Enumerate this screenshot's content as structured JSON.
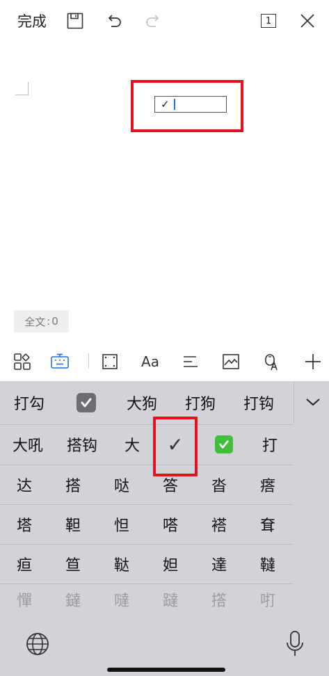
{
  "toolbar": {
    "done_label": "完成",
    "page_indicator": "1"
  },
  "document": {
    "input_content": "✓"
  },
  "status": {
    "wordcount_label": "全文",
    "wordcount_sep": ":",
    "wordcount_value": "0"
  },
  "format_toolbar": {
    "font_label": "Aa"
  },
  "candidates": {
    "row1": [
      "打勾",
      "大狗",
      "打狗",
      "打钩"
    ],
    "row2": [
      "大吼",
      "搭钩",
      "大",
      "✓",
      "打"
    ],
    "row3": [
      "达",
      "搭",
      "哒",
      "答",
      "沓",
      "瘩"
    ],
    "row4": [
      "塔",
      "靼",
      "怛",
      "嗒",
      "褡",
      "耷"
    ],
    "row5": [
      "疸",
      "笪",
      "鞑",
      "妲",
      "達",
      "韃"
    ],
    "row6": [
      "憚",
      "鐽",
      "噠",
      "躂",
      "撘",
      "咑"
    ]
  },
  "colors": {
    "highlight": "#e8101a",
    "accent": "#2a6fd6",
    "keyboard_bg": "#d1d3d9"
  },
  "icons": [
    "save-icon",
    "undo-icon",
    "redo-icon",
    "page-count-icon",
    "close-icon",
    "apps-icon",
    "keyboard-icon",
    "crop-icon",
    "align-icon",
    "image-icon",
    "voice-translate-icon",
    "add-icon",
    "checkbox-emoji-icon",
    "green-check-emoji-icon",
    "chevron-down-icon",
    "globe-icon",
    "microphone-icon"
  ]
}
